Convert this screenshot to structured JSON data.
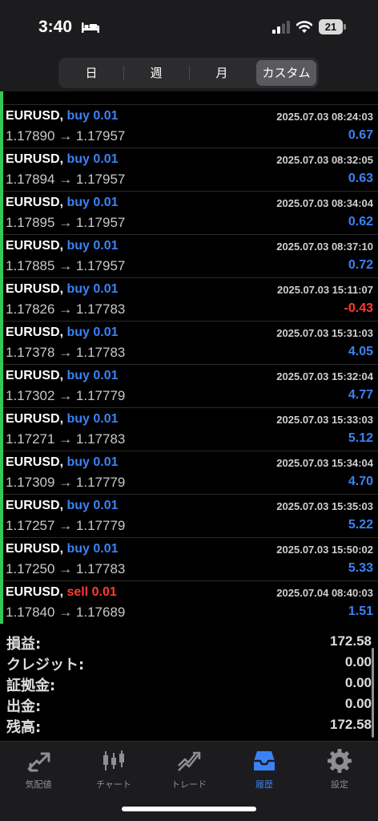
{
  "status_bar": {
    "time": "3:40",
    "battery": "21",
    "icons": [
      "bed-icon",
      "signal-icon",
      "wifi-icon",
      "battery-icon"
    ]
  },
  "period_tabs": [
    {
      "label": "日",
      "active": false
    },
    {
      "label": "週",
      "active": false
    },
    {
      "label": "月",
      "active": false
    },
    {
      "label": "カスタム",
      "active": true
    }
  ],
  "deals": [
    {
      "symbol": "EURUSD,",
      "side": "buy 0.01",
      "time": "2025.07.03 08:24:03",
      "open": "1.17890",
      "arrow": "→",
      "close": "1.17957",
      "profit": "0.67"
    },
    {
      "symbol": "EURUSD,",
      "side": "buy 0.01",
      "time": "2025.07.03 08:32:05",
      "open": "1.17894",
      "arrow": "→",
      "close": "1.17957",
      "profit": "0.63"
    },
    {
      "symbol": "EURUSD,",
      "side": "buy 0.01",
      "time": "2025.07.03 08:34:04",
      "open": "1.17895",
      "arrow": "→",
      "close": "1.17957",
      "profit": "0.62"
    },
    {
      "symbol": "EURUSD,",
      "side": "buy 0.01",
      "time": "2025.07.03 08:37:10",
      "open": "1.17885",
      "arrow": "→",
      "close": "1.17957",
      "profit": "0.72"
    },
    {
      "symbol": "EURUSD,",
      "side": "buy 0.01",
      "time": "2025.07.03 15:11:07",
      "open": "1.17826",
      "arrow": "→",
      "close": "1.17783",
      "profit": "-0.43"
    },
    {
      "symbol": "EURUSD,",
      "side": "buy 0.01",
      "time": "2025.07.03 15:31:03",
      "open": "1.17378",
      "arrow": "→",
      "close": "1.17783",
      "profit": "4.05"
    },
    {
      "symbol": "EURUSD,",
      "side": "buy 0.01",
      "time": "2025.07.03 15:32:04",
      "open": "1.17302",
      "arrow": "→",
      "close": "1.17779",
      "profit": "4.77"
    },
    {
      "symbol": "EURUSD,",
      "side": "buy 0.01",
      "time": "2025.07.03 15:33:03",
      "open": "1.17271",
      "arrow": "→",
      "close": "1.17783",
      "profit": "5.12"
    },
    {
      "symbol": "EURUSD,",
      "side": "buy 0.01",
      "time": "2025.07.03 15:34:04",
      "open": "1.17309",
      "arrow": "→",
      "close": "1.17779",
      "profit": "4.70"
    },
    {
      "symbol": "EURUSD,",
      "side": "buy 0.01",
      "time": "2025.07.03 15:35:03",
      "open": "1.17257",
      "arrow": "→",
      "close": "1.17779",
      "profit": "5.22"
    },
    {
      "symbol": "EURUSD,",
      "side": "buy 0.01",
      "time": "2025.07.03 15:50:02",
      "open": "1.17250",
      "arrow": "→",
      "close": "1.17783",
      "profit": "5.33"
    },
    {
      "symbol": "EURUSD,",
      "side": "sell 0.01",
      "time": "2025.07.04 08:40:03",
      "open": "1.17840",
      "arrow": "→",
      "close": "1.17689",
      "profit": "1.51"
    }
  ],
  "summary": [
    {
      "label": "損益:",
      "value": "172.58"
    },
    {
      "label": "クレジット:",
      "value": "0.00"
    },
    {
      "label": "証拠金:",
      "value": "0.00"
    },
    {
      "label": "出金:",
      "value": "0.00"
    },
    {
      "label": "残高:",
      "value": "172.58"
    }
  ],
  "tabbar": [
    {
      "label": "気配値",
      "icon": "quotes-icon",
      "active": false
    },
    {
      "label": "チャート",
      "icon": "chart-icon",
      "active": false
    },
    {
      "label": "トレード",
      "icon": "trade-icon",
      "active": false
    },
    {
      "label": "履歴",
      "icon": "history-icon",
      "active": true
    },
    {
      "label": "設定",
      "icon": "settings-icon",
      "active": false
    }
  ],
  "colors": {
    "buy": "#3b82f6",
    "sell": "#ff3b30",
    "profit_positive": "#3b82f6",
    "profit_negative": "#ff3b30",
    "deal_marker": "#34c759",
    "active_tab": "#3b82f6"
  }
}
